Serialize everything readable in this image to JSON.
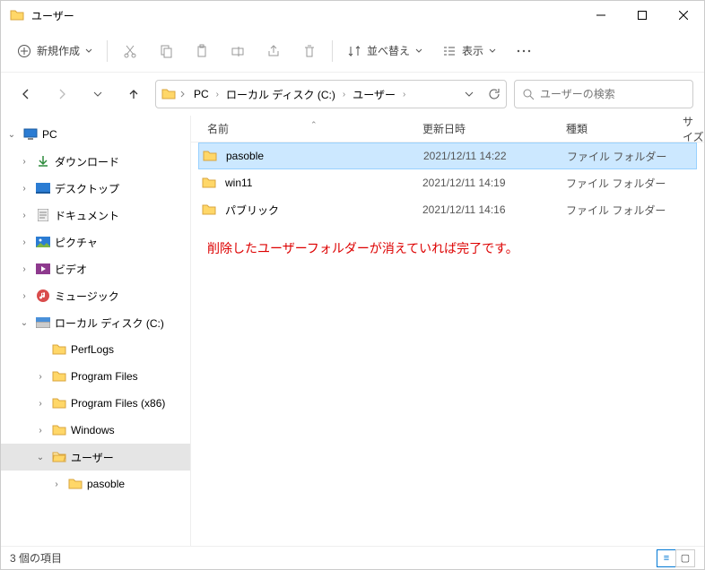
{
  "window": {
    "title": "ユーザー"
  },
  "toolbar": {
    "new": "新規作成",
    "sort": "並べ替え",
    "view": "表示"
  },
  "breadcrumb": {
    "pc": "PC",
    "drive": "ローカル ディスク (C:)",
    "folder": "ユーザー"
  },
  "search": {
    "placeholder": "ユーザーの検索"
  },
  "columns": {
    "name": "名前",
    "date": "更新日時",
    "type": "種類",
    "size": "サイズ"
  },
  "sidebar": {
    "pc": "PC",
    "downloads": "ダウンロード",
    "desktop": "デスクトップ",
    "documents": "ドキュメント",
    "pictures": "ピクチャ",
    "videos": "ビデオ",
    "music": "ミュージック",
    "cdrive": "ローカル ディスク (C:)",
    "perflogs": "PerfLogs",
    "progfiles": "Program Files",
    "progfiles86": "Program Files (x86)",
    "windows": "Windows",
    "users": "ユーザー",
    "pasoble": "pasoble"
  },
  "rows": [
    {
      "name": "pasoble",
      "date": "2021/12/11 14:22",
      "type": "ファイル フォルダー"
    },
    {
      "name": "win11",
      "date": "2021/12/11 14:19",
      "type": "ファイル フォルダー"
    },
    {
      "name": "パブリック",
      "date": "2021/12/11 14:16",
      "type": "ファイル フォルダー"
    }
  ],
  "annotation": "削除したユーザーフォルダーが消えていれば完了です。",
  "status": {
    "count": "3 個の項目"
  }
}
